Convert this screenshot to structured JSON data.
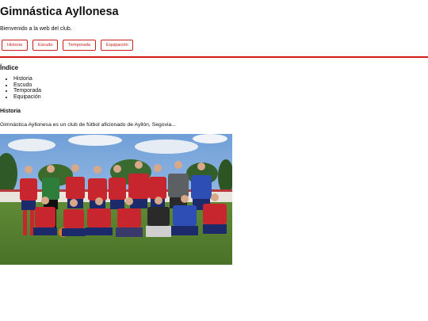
{
  "header": {
    "title": "Gimnástica Ayllonesa",
    "welcome": "Bienvenido a la web del club."
  },
  "nav": {
    "items": [
      "Historia",
      "Escudo",
      "Temporada",
      "Equipación"
    ]
  },
  "index": {
    "heading": "Índice",
    "items": [
      "Historia",
      "Escudo",
      "Temporada",
      "Equipación"
    ]
  },
  "historia": {
    "heading": "Historia",
    "text": "Gimnástica Ayllonesa es un club de fútbol aficionado de Ayllón, Segovia..."
  },
  "colors": {
    "accent": "#d11b1b",
    "kit_red": "#c8262e",
    "keeper_green": "#2f7d3a",
    "blue_kit": "#2d4fb5"
  }
}
